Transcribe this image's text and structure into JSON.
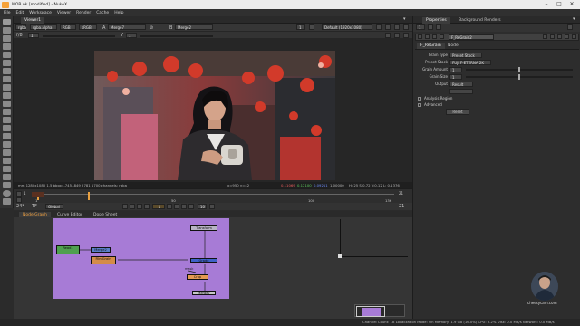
{
  "window": {
    "title": "MOB.nk [modified] - NukeX",
    "minimize": "–",
    "maximize": "□",
    "close": "✕"
  },
  "menu": [
    "File",
    "Edit",
    "Workspace",
    "Viewer",
    "Render",
    "Cache",
    "Help"
  ],
  "viewer": {
    "tab": "Viewer1",
    "channels": "rgba",
    "channel_sub": "rgba.alpha",
    "colorspace": "RGB",
    "lut": "sRGB",
    "input_a": "A",
    "input_a_node": "Merge7",
    "input_b": "B",
    "input_b_node": "Merge2",
    "zoom": "1",
    "frame_field": "Default (1920x1080)",
    "gain_label": "f/8",
    "gain_value": "1",
    "gamma_label": "Y",
    "gamma_value": "1",
    "info_left": "mm 1280x1080 1.5 bbox: -745 -849 2781 1700 channels: rgba",
    "info_mid": "x=950 y=42",
    "info_r": "0.11069",
    "info_g": "0.12100",
    "info_b": "0.09211",
    "info_a": "1.00000",
    "info_right": "H: 25 S:0.72 V:0.12  L: 0.1376"
  },
  "timeline": {
    "start": "1",
    "end": "21",
    "ticks": [
      "1",
      "50",
      "100",
      "136"
    ],
    "fps_label": "24*",
    "tf_label": "TF",
    "global": "Global",
    "frame_current": "1",
    "step": "10",
    "end2": "21"
  },
  "nodegraph": {
    "tabs": [
      "Node Graph",
      "Curve Editor",
      "Dope Sheet"
    ],
    "nodes": [
      "Read1",
      "Merge2",
      "FilmGrain",
      "Transform",
      "Grade",
      "Crop",
      "Merge7",
      "Viewer1"
    ]
  },
  "properties": {
    "tabs": [
      "Properties",
      "Background Renders"
    ],
    "count": "1",
    "node_name": "F_ReGrain2",
    "subtabs": [
      "F_ReGrain",
      "Node"
    ],
    "fields": [
      {
        "label": "Grain Type",
        "value": "Preset Stock"
      },
      {
        "label": "Preset Stock",
        "value": "FUJI F-ETERNA 2K"
      }
    ],
    "sliders": [
      {
        "label": "Grain Amount",
        "value": "1",
        "fraction": 0.5
      },
      {
        "label": "Grain Size",
        "value": "1",
        "fraction": 0.5
      }
    ],
    "output": {
      "label": "Output",
      "value": "Result"
    },
    "checks": [
      "Analysis Region",
      "Advanced"
    ],
    "button": "Reset"
  },
  "status": "Channel Count: 18  Localization Mode: On  Memory: 1.9 GB (16.0%)  CPU: 3.2%  Disk: 0.0 MB/s  Network: 0.0 MB/s",
  "watermark": "cheesycam.com"
}
